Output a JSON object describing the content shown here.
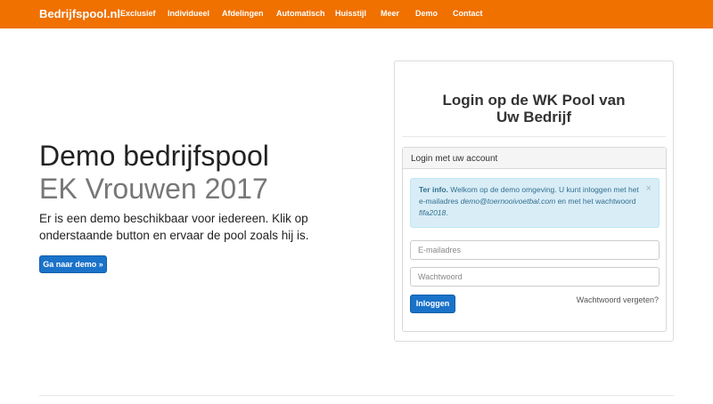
{
  "navbar": {
    "brand": "Bedrijfspool.nl",
    "items": [
      "Exclusief",
      "Individueel",
      "Afdelingen",
      "Automatisch",
      "Huisstijl",
      "Meer",
      "Demo",
      "Contact"
    ]
  },
  "hero": {
    "title": "Demo bedrijfspool",
    "subtitle": "EK Vrouwen 2017",
    "text": "Er is een demo beschikbaar voor iedereen. Klik op onderstaande button en ervaar de pool zoals hij is.",
    "button_label": "Ga naar demo »"
  },
  "login": {
    "heading_line1": "Login op de WK Pool van",
    "heading_line2": "Uw Bedrijf",
    "panel_title": "Login met uw account",
    "alert": {
      "strong": "Ter info.",
      "text1": " Welkom op de demo omgeving. U kunt inloggen met het e-mailadres ",
      "email": "demo@toernooivoetbal.com",
      "text2": " en met het wachtwoord ",
      "password": "fifa2018",
      "text3": ".",
      "close": "×"
    },
    "email_placeholder": "E-mailadres",
    "password_placeholder": "Wachtwoord",
    "submit_label": "Inloggen",
    "forgot_label": "Wachtwoord vergeten?"
  },
  "colors": {
    "navbar": "#f07000",
    "primary_button": "#1a72c9",
    "alert_background": "#d9edf7"
  }
}
